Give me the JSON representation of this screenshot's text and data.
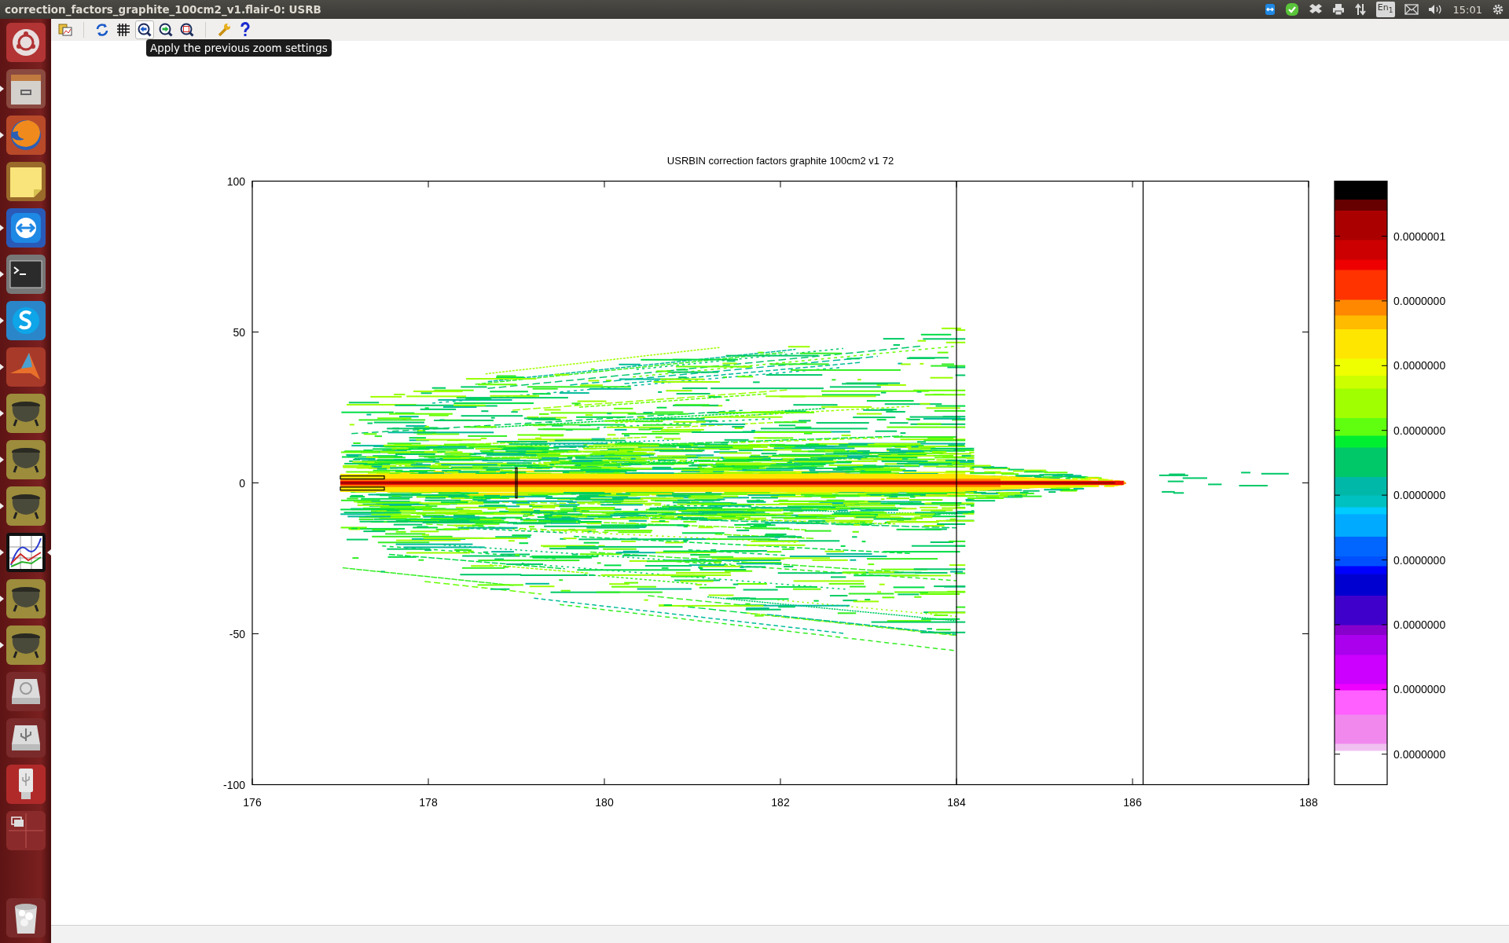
{
  "window": {
    "title": "correction_factors_graphite_100cm2_v1.flair-0: USRB"
  },
  "top_panel": {
    "keyboard_layout": "En$_{1}$",
    "clock": "15:01"
  },
  "launcher": {
    "items": [
      {
        "running": false,
        "active": false
      },
      {
        "running": true,
        "active": false
      },
      {
        "running": true,
        "active": false
      },
      {
        "running": false,
        "active": false
      },
      {
        "running": true,
        "active": false
      },
      {
        "running": true,
        "active": false
      },
      {
        "running": true,
        "active": false
      },
      {
        "running": true,
        "active": false
      },
      {
        "running": true,
        "active": false
      },
      {
        "running": true,
        "active": false
      },
      {
        "running": true,
        "active": false
      },
      {
        "running": true,
        "active": true
      },
      {
        "running": true,
        "active": false
      },
      {
        "running": true,
        "active": false
      },
      {
        "running": false,
        "active": false
      },
      {
        "running": false,
        "active": false
      },
      {
        "running": false,
        "active": false
      },
      {
        "running": false,
        "active": false
      },
      {
        "running": false,
        "active": false
      }
    ]
  },
  "toolbar": {
    "buttons": [
      {
        "hovered": false
      },
      {
        "hovered": false
      },
      {
        "hovered": false
      },
      {
        "hovered": true
      },
      {
        "hovered": false
      },
      {
        "hovered": false
      },
      {
        "hovered": false
      },
      {
        "hovered": false
      }
    ],
    "tooltip": "Apply the previous zoom settings"
  },
  "plot": {
    "title": "USRBIN correction factors graphite 100cm2 v1 72",
    "x_ticks": [
      "176",
      "178",
      "180",
      "182",
      "184",
      "186",
      "188"
    ],
    "y_ticks": [
      "100",
      "50",
      "0",
      "-50",
      "-100"
    ],
    "colorbar_labels": [
      "0.0000001",
      "0.0000000",
      "0.0000000",
      "0.0000000",
      "0.0000000",
      "0.0000000",
      "0.0000000",
      "0.0000000",
      "0.0000000"
    ]
  }
}
